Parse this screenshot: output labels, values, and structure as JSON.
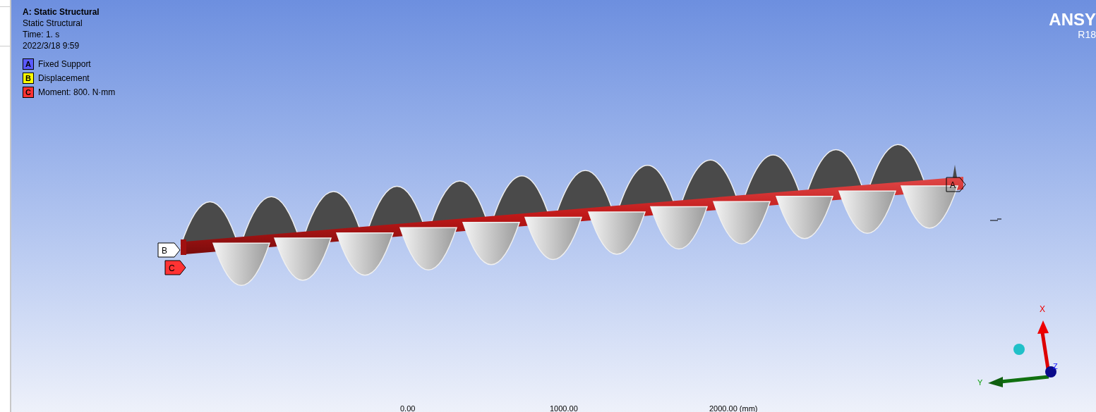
{
  "header": {
    "title": "A: Static Structural",
    "lines": [
      "Static Structural",
      "Time: 1. s",
      "2022/3/18 9:59"
    ]
  },
  "legend": [
    {
      "letter": "A",
      "label": "Fixed Support",
      "color": "#5a5aff"
    },
    {
      "letter": "B",
      "label": "Displacement",
      "color": "#ffff00"
    },
    {
      "letter": "C",
      "label": "Moment: 800. N·mm",
      "color": "#ff3333"
    }
  ],
  "model_tags": [
    {
      "letter": "A",
      "kind": "outline"
    },
    {
      "letter": "B",
      "kind": "filled",
      "color": "#ffffff"
    },
    {
      "letter": "C",
      "kind": "filled",
      "color": "#ff3333"
    }
  ],
  "logo": {
    "name": "ANSY",
    "version": "R18"
  },
  "triad": {
    "x": "X",
    "y": "Y",
    "z": "Z"
  },
  "scale_labels": [
    "0.00",
    "1000.00",
    "2000.00 (mm)"
  ]
}
